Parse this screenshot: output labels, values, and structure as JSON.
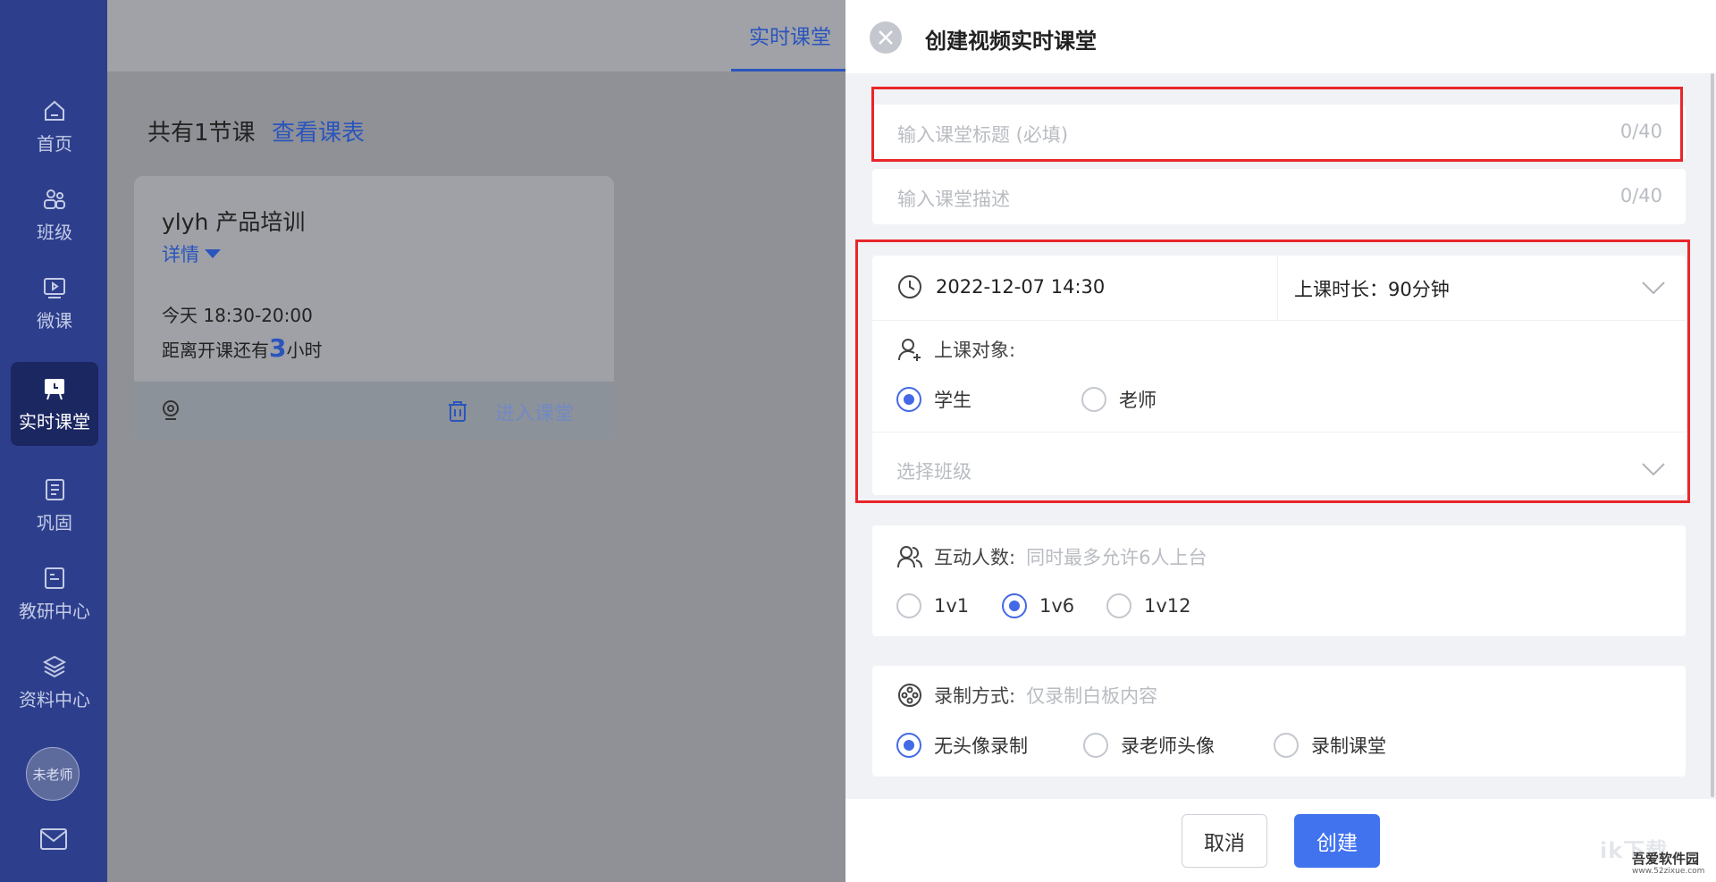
{
  "sidebar": {
    "items": [
      {
        "label": "首页",
        "icon": "home-icon"
      },
      {
        "label": "班级",
        "icon": "class-icon"
      },
      {
        "label": "微课",
        "icon": "video-icon"
      },
      {
        "label": "实时课堂",
        "icon": "live-class-icon"
      },
      {
        "label": "巩固",
        "icon": "notebook-icon"
      },
      {
        "label": "教研中心",
        "icon": "research-icon"
      },
      {
        "label": "资料中心",
        "icon": "layers-icon"
      }
    ],
    "active_index": 3,
    "avatar_label": "未老师"
  },
  "topbar": {
    "active_tab": "实时课堂"
  },
  "main": {
    "count_title": "共有1节课",
    "schedule_link": "查看课表",
    "course": {
      "name": "ylyh 产品培训",
      "details_label": "详情",
      "time": "今天 18:30-20:00",
      "countdown_prefix": "距离开课还有",
      "countdown_value": "3",
      "countdown_suffix": "小时",
      "enter_label": "进入课堂"
    }
  },
  "modal": {
    "title": "创建视频实时课堂",
    "title_field": {
      "placeholder": "输入课堂标题 (必填)",
      "counter": "0/40"
    },
    "desc_field": {
      "placeholder": "输入课堂描述",
      "counter": "0/40"
    },
    "datetime": "2022-12-07 14:30",
    "duration": "上课时长：90分钟",
    "audience": {
      "label": "上课对象:",
      "options": [
        "学生",
        "老师"
      ],
      "selected": "学生"
    },
    "class_select_placeholder": "选择班级",
    "interaction": {
      "label": "互动人数:",
      "hint": "同时最多允许6人上台",
      "options": [
        "1v1",
        "1v6",
        "1v12"
      ],
      "selected": "1v6"
    },
    "recording": {
      "label": "录制方式:",
      "hint": "仅录制白板内容",
      "options": [
        "无头像录制",
        "录老师头像",
        "录制课堂"
      ],
      "selected": "无头像录制"
    },
    "cancel_label": "取消",
    "create_label": "创建"
  },
  "watermark": {
    "big": "ik下载",
    "name": "吾爱软件园",
    "url": "www.52zixue.com"
  },
  "colors": {
    "sidebar": "#2d3f8c",
    "accent": "#4369e6",
    "primary_button": "#4173ef",
    "highlight": "#e8262a"
  }
}
